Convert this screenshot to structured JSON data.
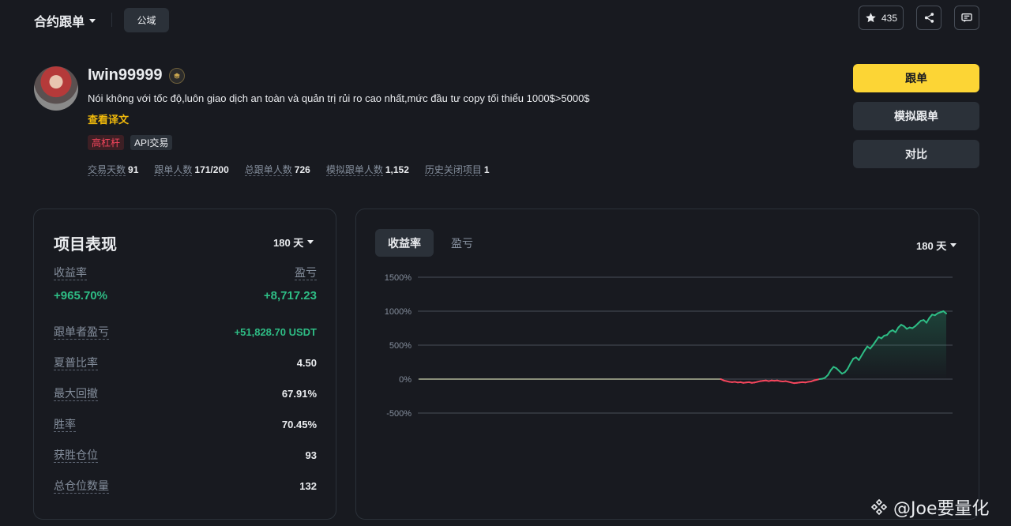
{
  "nav": {
    "title": "合约跟单",
    "public_label": "公域",
    "favorites_count": "435"
  },
  "profile": {
    "username": "Iwin99999",
    "bio": "Nói không với tốc độ,luôn giao dịch an toàn và quản trị rủi ro cao nhất,mức đầu tư copy tối thiểu 1000$>5000$",
    "translate_label": "查看译文",
    "tags": [
      "高杠杆",
      "API交易"
    ],
    "stats": [
      {
        "label": "交易天数",
        "value": "91"
      },
      {
        "label": "跟单人数",
        "value": "171/200"
      },
      {
        "label": "总跟单人数",
        "value": "726"
      },
      {
        "label": "模拟跟单人数",
        "value": "1,152"
      },
      {
        "label": "历史关闭项目",
        "value": "1"
      }
    ]
  },
  "actions": {
    "copy_label": "跟单",
    "mock_copy_label": "模拟跟单",
    "compare_label": "对比"
  },
  "performance": {
    "title": "项目表现",
    "range": "180 天",
    "roi_label": "收益率",
    "roi_value": "+965.70%",
    "pnl_label": "盈亏",
    "pnl_value": "+8,717.23",
    "metrics": [
      {
        "label": "跟单者盈亏",
        "value": "+51,828.70 USDT",
        "positive": true
      },
      {
        "label": "夏普比率",
        "value": "4.50"
      },
      {
        "label": "最大回撤",
        "value": "67.91%"
      },
      {
        "label": "胜率",
        "value": "70.45%"
      },
      {
        "label": "获胜仓位",
        "value": "93"
      },
      {
        "label": "总仓位数量",
        "value": "132"
      }
    ]
  },
  "chart_panel": {
    "tabs": [
      "收益率",
      "盈亏"
    ],
    "active_tab": 0,
    "range": "180 天"
  },
  "chart_data": {
    "type": "line",
    "title": "",
    "xlabel": "",
    "ylabel": "",
    "ylim": [
      -500,
      1500
    ],
    "yticks": [
      "1500%",
      "1000%",
      "500%",
      "0%",
      "-500%"
    ],
    "ytick_values": [
      1500,
      1000,
      500,
      0,
      -500
    ],
    "grid": true,
    "colors": {
      "positive": "#2ebd85",
      "negative": "#f6465d",
      "neutral": "#848e9c"
    },
    "series": [
      {
        "values": [
          0,
          0,
          0,
          0,
          0,
          0,
          0,
          0,
          0,
          0,
          0,
          0,
          0,
          0,
          0,
          0,
          0,
          0,
          0,
          0,
          0,
          0,
          0,
          0,
          0,
          0,
          0,
          0,
          0,
          0,
          0,
          0,
          0,
          0,
          0,
          0,
          0,
          0,
          0,
          0,
          0,
          0,
          0,
          0,
          0,
          0,
          0,
          0,
          0,
          0,
          0,
          0,
          0,
          0,
          0,
          0,
          0,
          0,
          0,
          0,
          0,
          0,
          0,
          0,
          0,
          0,
          0,
          0,
          0,
          0,
          0,
          0,
          0,
          0,
          0,
          0,
          0,
          0,
          0,
          0,
          0,
          0,
          0,
          0,
          0,
          0,
          0,
          0,
          0,
          0,
          0,
          0,
          0,
          0,
          0,
          0,
          0,
          0,
          0,
          0,
          0,
          0,
          0,
          0,
          0,
          0,
          0,
          0,
          -20,
          -30,
          -40,
          -45,
          -40,
          -50,
          -45,
          -55,
          -50,
          -45,
          -55,
          -50,
          -40,
          -30,
          -25,
          -20,
          -30,
          -20,
          -25,
          -20,
          -30,
          -35,
          -30,
          -40,
          -50,
          -60,
          -55,
          -50,
          -45,
          -50,
          -40,
          -35,
          -20,
          -10,
          0,
          5,
          20,
          60,
          130,
          180,
          160,
          120,
          80,
          100,
          150,
          230,
          300,
          320,
          280,
          350,
          420,
          480,
          450,
          500,
          560,
          620,
          600,
          640,
          650,
          700,
          720,
          690,
          760,
          800,
          780,
          740,
          760,
          750,
          780,
          820,
          860,
          870,
          830,
          900,
          950,
          940,
          970,
          985,
          1000,
          965.7
        ]
      }
    ]
  },
  "watermark": "@Joe要量化"
}
